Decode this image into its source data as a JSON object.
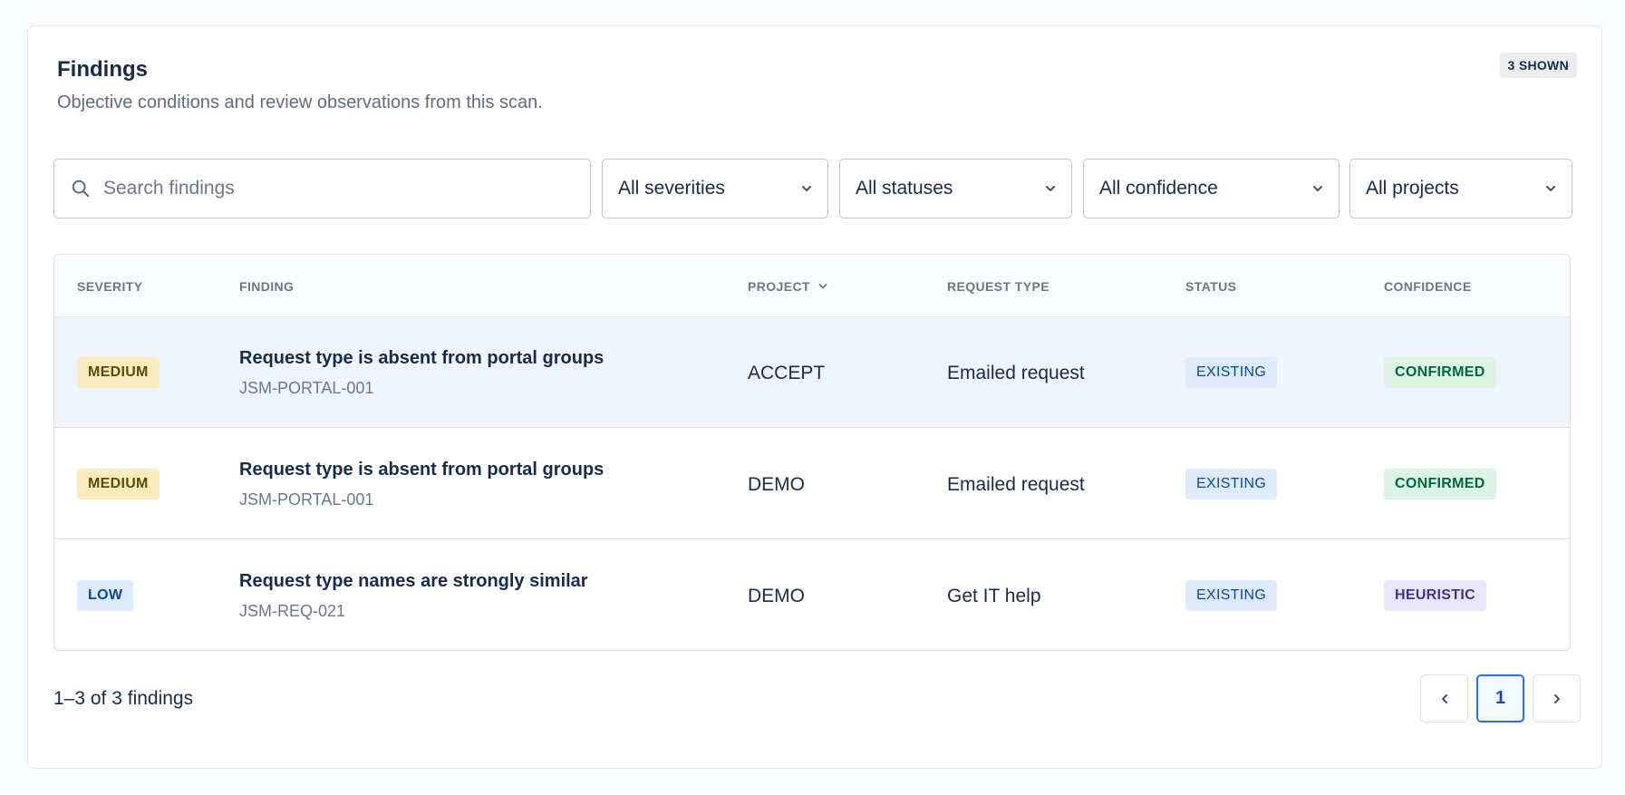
{
  "panel": {
    "title": "Findings",
    "subtitle": "Objective conditions and review observations from this scan.",
    "shown_badge": "3 SHOWN"
  },
  "filters": {
    "search_placeholder": "Search findings",
    "severity": "All severities",
    "status": "All statuses",
    "confidence": "All confidence",
    "project": "All projects"
  },
  "table": {
    "headers": {
      "severity": "SEVERITY",
      "finding": "FINDING",
      "project": "PROJECT",
      "request_type": "REQUEST TYPE",
      "status": "STATUS",
      "confidence": "CONFIDENCE"
    },
    "rows": [
      {
        "severity": "MEDIUM",
        "title": "Request type is absent from portal groups",
        "id": "JSM-PORTAL-001",
        "project": "ACCEPT",
        "request_type": "Emailed request",
        "status": "EXISTING",
        "confidence": "CONFIRMED"
      },
      {
        "severity": "MEDIUM",
        "title": "Request type is absent from portal groups",
        "id": "JSM-PORTAL-001",
        "project": "DEMO",
        "request_type": "Emailed request",
        "status": "EXISTING",
        "confidence": "CONFIRMED"
      },
      {
        "severity": "LOW",
        "title": "Request type names are strongly similar",
        "id": "JSM-REQ-021",
        "project": "DEMO",
        "request_type": "Get IT help",
        "status": "EXISTING",
        "confidence": "HEURISTIC"
      }
    ]
  },
  "footer": {
    "count_text": "1–3 of 3 findings",
    "current_page": "1"
  },
  "icons": {
    "search": "search-icon",
    "dropdown": "chevron-down-icon",
    "prev": "chevron-left-icon",
    "next": "chevron-right-icon"
  },
  "colors": {
    "accent": "#2f6fd8",
    "medium_bg": "#fbecc0",
    "low_bg": "#deebff",
    "confirmed_bg": "#dcf3e6",
    "heuristic_bg": "#eae6ff",
    "selected_row_bg": "#f0f5fd"
  }
}
